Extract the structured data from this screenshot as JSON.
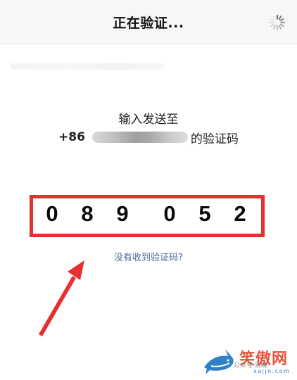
{
  "navbar": {
    "title": "正在验证...",
    "spinner_icon": "loading-spinner-icon"
  },
  "prompt": {
    "line1": "输入发送至",
    "country_code": "+86",
    "suffix": "的验证码"
  },
  "code": {
    "digits": [
      "0",
      "8",
      "9",
      "0",
      "5",
      "2"
    ]
  },
  "link": {
    "resend_label": "没有收到验证码?"
  },
  "annotation": {
    "highlight_color": "#e62f2f",
    "arrow_color": "#e62f2f"
  },
  "watermark": {
    "brand": "笑傲网",
    "domain": "xajjn.com",
    "overlay": "公众号·百晓"
  }
}
